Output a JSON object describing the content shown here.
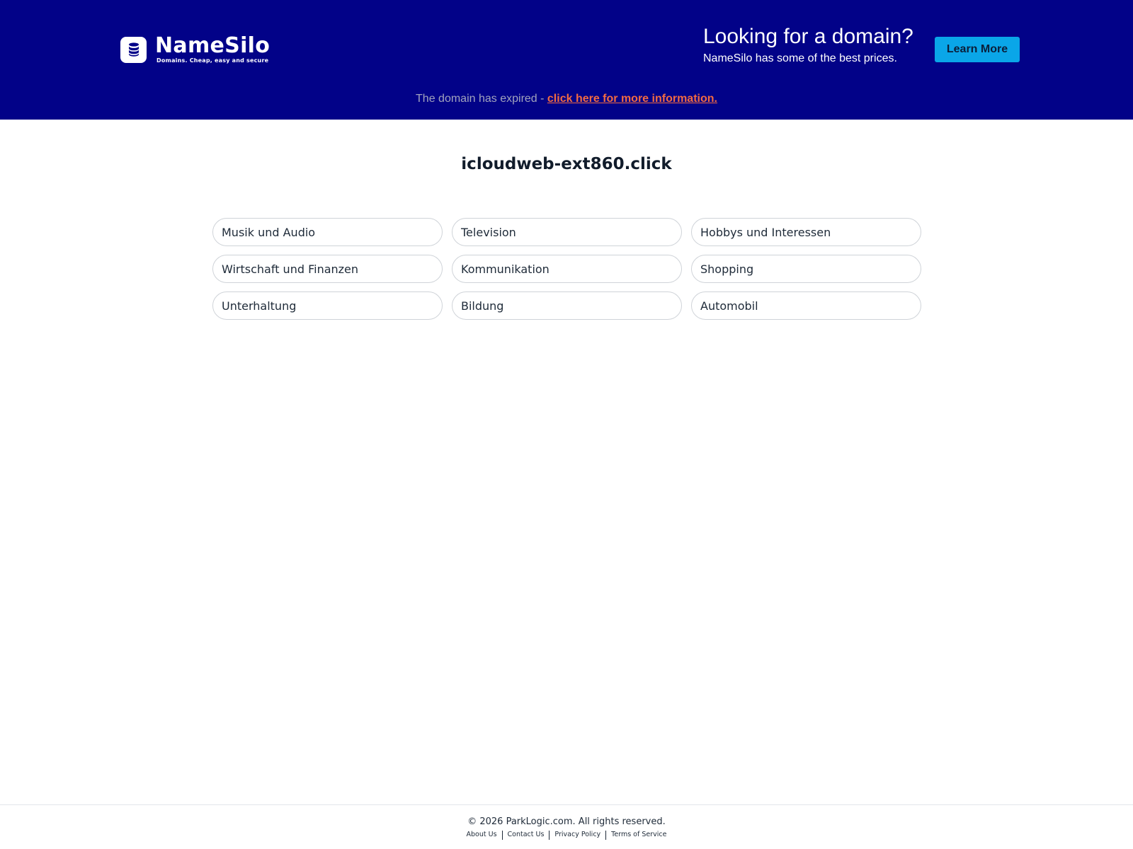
{
  "banner": {
    "logo": {
      "name": "NameSilo",
      "tagline": "Domains. Cheap, easy and secure",
      "icon": "database-icon"
    },
    "promo": {
      "title": "Looking for a domain?",
      "subtitle": "NameSilo has some of the best prices.",
      "button_label": "Learn More"
    },
    "notice": {
      "text": "The domain has expired - ",
      "link_label": "click here for more information."
    }
  },
  "main": {
    "domain": "icloudweb-ext860.click",
    "related_links": [
      "Musik und Audio",
      "Television",
      "Hobbys und Interessen",
      "Wirtschaft und Finanzen",
      "Kommunikation",
      "Shopping",
      "Unterhaltung",
      "Bildung",
      "Automobil"
    ]
  },
  "footer": {
    "copyright": "© 2026 ParkLogic.com. All rights reserved.",
    "links": [
      "About Us",
      "Contact Us",
      "Privacy Policy",
      "Terms of Service"
    ]
  },
  "colors": {
    "banner_bg": "#020288",
    "button_bg": "#0aa6e8",
    "notice_link": "#f26a42",
    "notice_text": "#a2a4bd"
  }
}
